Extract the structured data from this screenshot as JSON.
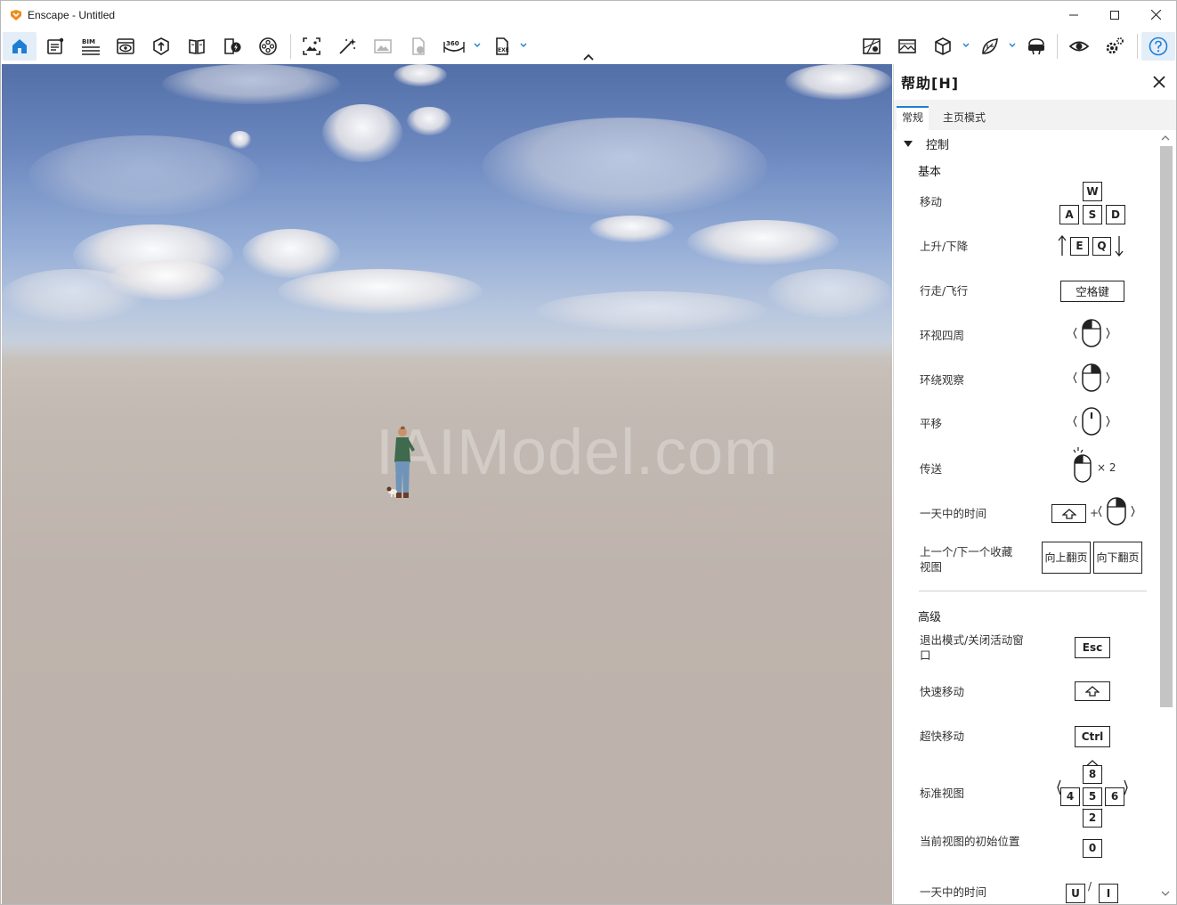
{
  "window": {
    "title": "Enscape - Untitled"
  },
  "viewport": {
    "watermark": "IAIModel.com"
  },
  "help_panel": {
    "title": "帮助[H]",
    "tabs": [
      {
        "label": "常规",
        "active": true
      },
      {
        "label": "主页模式",
        "active": false
      }
    ],
    "section_title": "控制",
    "basic_title": "基本",
    "advanced_title": "高级",
    "basic_rows": {
      "move": "移动",
      "up_down": "上升/下降",
      "walk_fly": "行走/飞行",
      "look_around": "环视四周",
      "orbit": "环绕观察",
      "pan": "平移",
      "teleport": "传送",
      "time_of_day": "一天中的时间",
      "prev_next_view": "上一个/下一个收藏视图"
    },
    "advanced_rows": {
      "exit_mode": "退出模式/关闭活动窗口",
      "fast_move": "快速移动",
      "ultra_fast": "超快移动",
      "standard_views": "标准视图",
      "initial_pos": "当前视图的初始位置",
      "time_of_day": "一天中的时间"
    },
    "keys": {
      "w": "W",
      "a": "A",
      "s": "S",
      "d": "D",
      "e": "E",
      "q": "Q",
      "space": "空格键",
      "times_two": "× 2",
      "plus": "+",
      "page_up": "向上翻页",
      "page_down": "向下翻页",
      "esc": "Esc",
      "ctrl": "Ctrl",
      "num8": "8",
      "num4": "4",
      "num5": "5",
      "num6": "6",
      "num2": "2",
      "num0": "0",
      "u": "U",
      "i": "I",
      "slash": "/"
    }
  },
  "colors": {
    "accent": "#1e7ed4",
    "logo": "#f08c1e"
  }
}
